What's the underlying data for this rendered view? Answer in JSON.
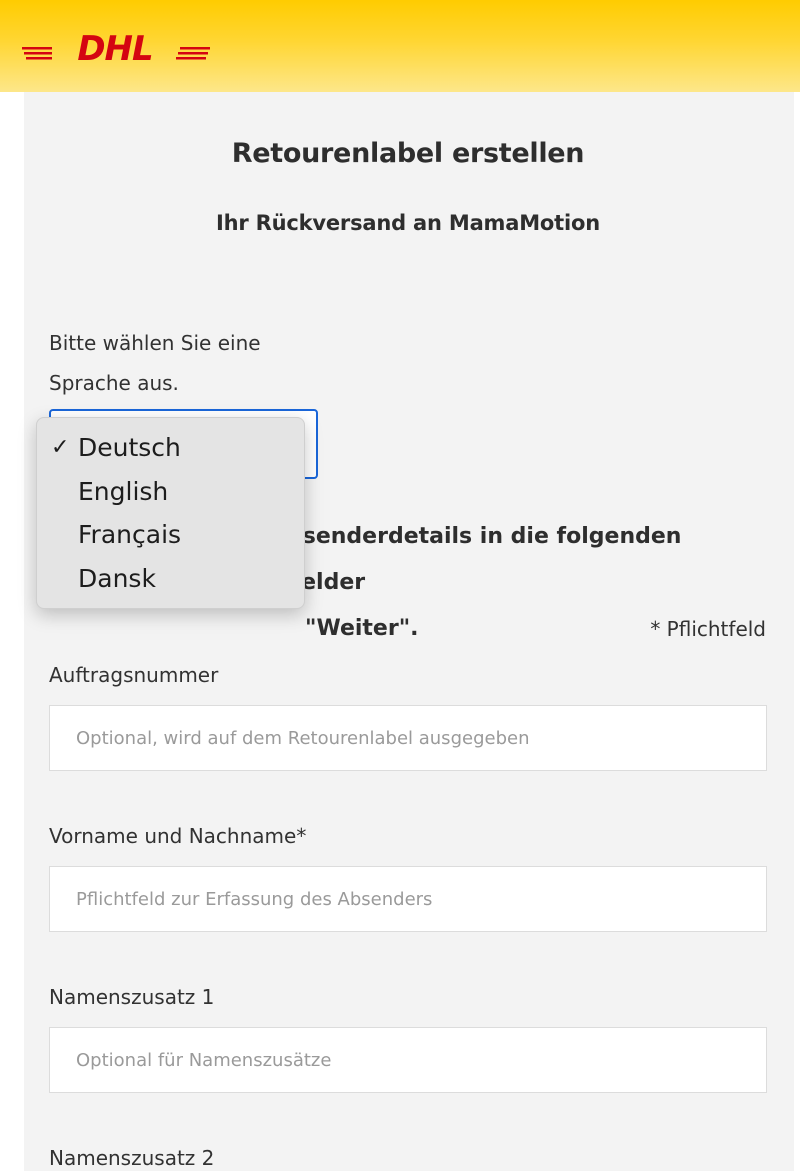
{
  "header": {
    "logo_text": "DHL",
    "brand_color": "#ffcc00",
    "logo_color": "#d40511"
  },
  "page": {
    "title": "Retourenlabel erstellen",
    "subtitle": "Ihr Rückversand an MamaMotion"
  },
  "language": {
    "label": "Bitte wählen Sie eine Sprache aus.",
    "selected": "Deutsch",
    "options": [
      "Deutsch",
      "English",
      "Français",
      "Dansk"
    ],
    "check_icon": "✓"
  },
  "instructions": {
    "line1_visible": "bsenderdetails in die folgenden Felder",
    "line2_visible": "\"Weiter\"."
  },
  "required_note": "* Pflichtfeld",
  "form": {
    "fields": [
      {
        "label": "Auftragsnummer",
        "placeholder": "Optional, wird auf dem Retourenlabel ausgegeben",
        "value": ""
      },
      {
        "label": "Vorname und Nachname*",
        "placeholder": "Pflichtfeld zur Erfassung des Absenders",
        "value": ""
      },
      {
        "label": "Namenszusatz 1",
        "placeholder": "Optional für Namenszusätze",
        "value": ""
      },
      {
        "label": "Namenszusatz 2"
      }
    ]
  }
}
